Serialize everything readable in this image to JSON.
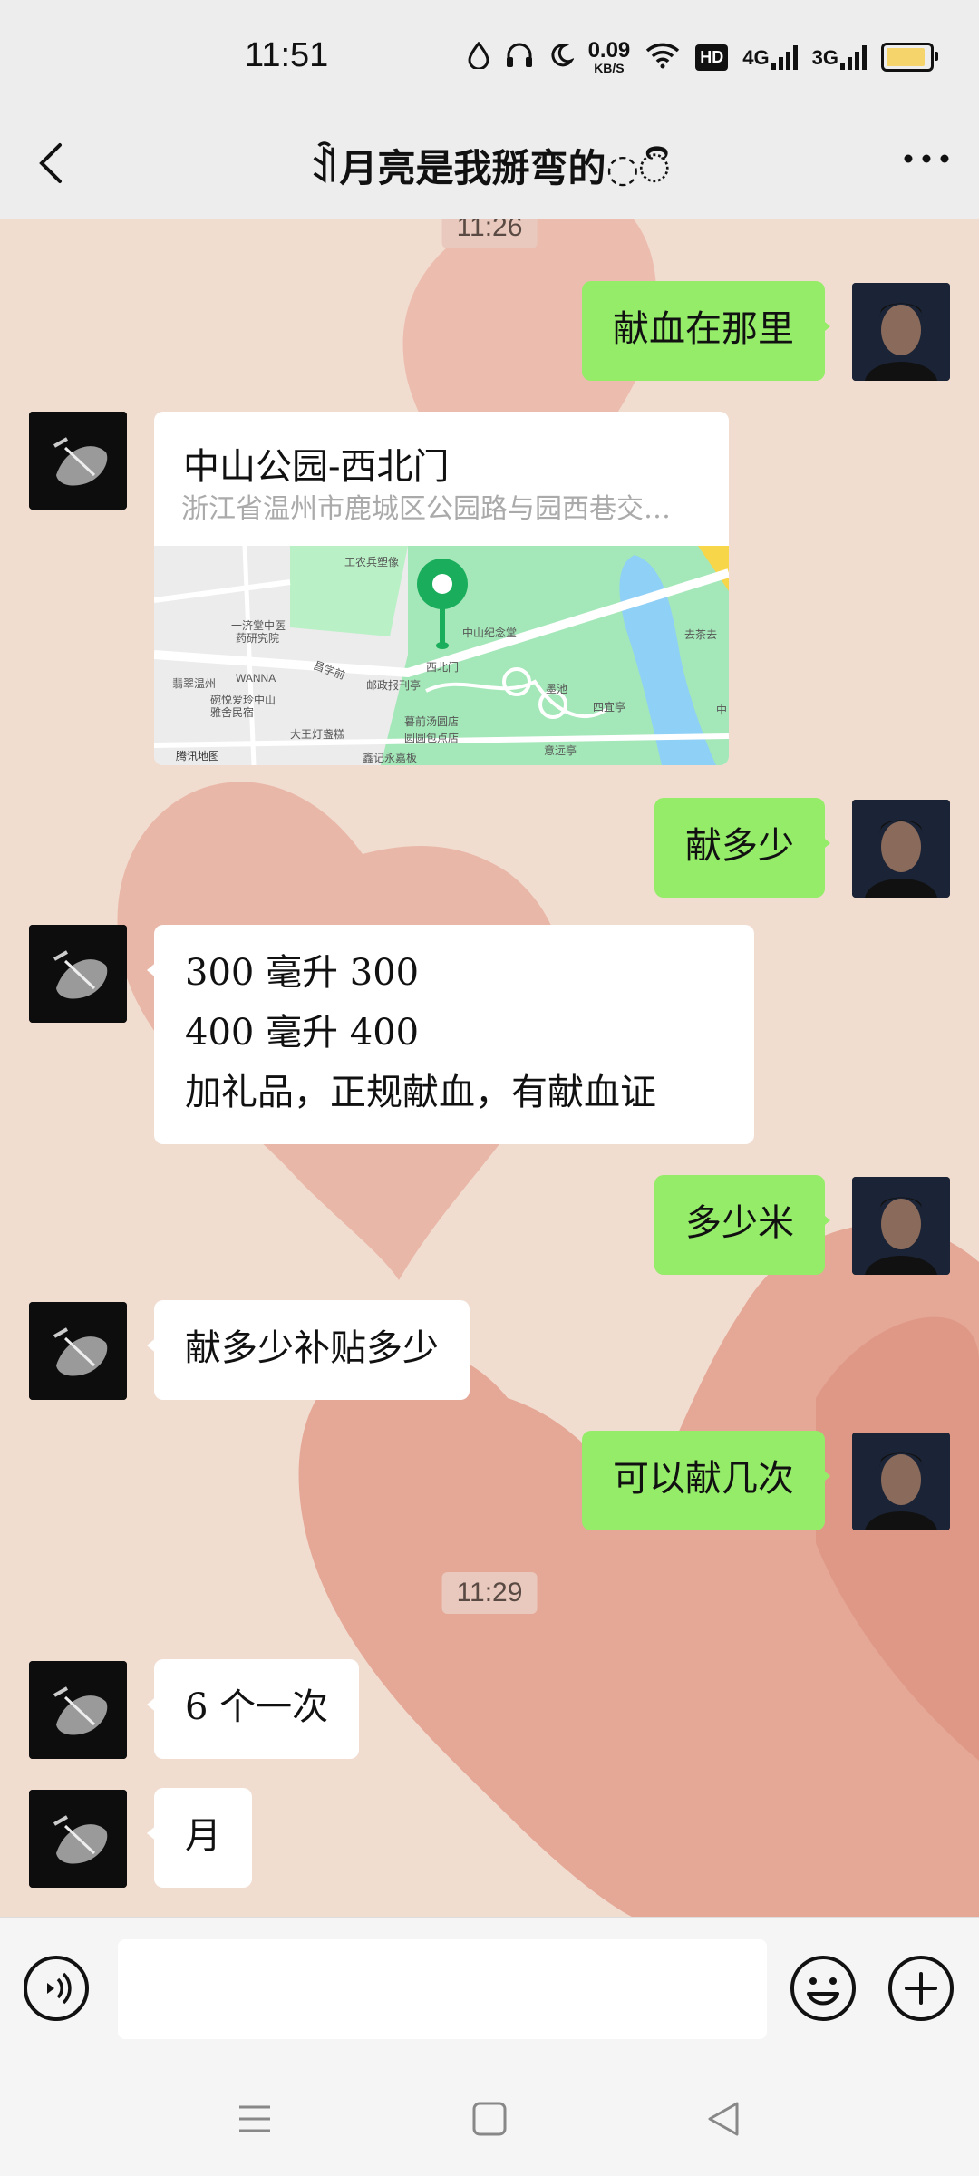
{
  "status": {
    "time": "11:51",
    "net_speed": "0.09",
    "net_unit": "KB/S",
    "hd": "HD",
    "sim1": "4G",
    "sim2": "3G"
  },
  "header": {
    "title": "ꀉ月亮是我掰弯的◌ි"
  },
  "chat": {
    "timestamps": [
      "11:26",
      "11:29"
    ],
    "messages": {
      "m1": "献血在那里",
      "loc_title": "中山公园-西北门",
      "loc_address": "浙江省温州市鹿城区公园路与园西巷交…",
      "m2": "献多少",
      "m3_line1": "300 毫升 300",
      "m3_line2": "400 毫升 400",
      "m3_line3": "加礼品，正规献血，有献血证",
      "m4": "多少米",
      "m5": "献多少补贴多少",
      "m6": "可以献几次",
      "m7": "6 个一次",
      "m8": "月"
    }
  },
  "map_labels": {
    "l1": "工农兵塑像",
    "l2": "一济堂中医",
    "l3": "药研究院",
    "l4": "中山纪念堂",
    "l5": "去茶去",
    "l6": "昌学前",
    "l7": "翡翠温州",
    "l8": "WANNA",
    "l9": "邮政报刊亭",
    "l10": "西北门",
    "l11": "碗悦爱玲中山",
    "l12": "雅舍民宿",
    "l13": "大王灯盏糕",
    "l14": "暮前汤圆店",
    "l15": "圆圆包点店",
    "l16": "鑫记永嘉板",
    "l17": "墨池",
    "l18": "四宜亭",
    "l19": "意远亭",
    "l20": "腾讯地图",
    "l21": "中"
  },
  "colors": {
    "my_bubble": "#95ec69",
    "their_bubble": "#ffffff",
    "chat_bg": "#f1ddd0",
    "map_pin": "#1aad5c"
  },
  "icons": {
    "back": "chevron-left-icon",
    "more": "more-icon",
    "voice": "voice-icon",
    "emoji": "emoji-icon",
    "plus": "plus-icon",
    "nav_menu": "menu-icon",
    "nav_home": "home-icon",
    "nav_back": "back-triangle-icon"
  }
}
